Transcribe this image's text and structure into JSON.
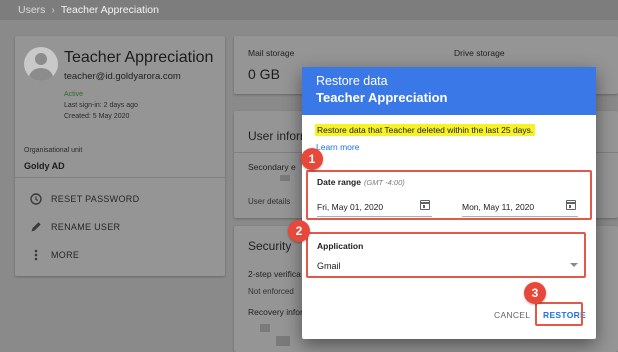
{
  "breadcrumb": {
    "parent": "Users",
    "current": "Teacher Appreciation"
  },
  "user": {
    "name": "Teacher Appreciation",
    "email": "teacher@id.goldyarora.com",
    "status": "Active",
    "last_signin": "Last sign-in: 2 days ago",
    "created": "Created: 5 May 2020"
  },
  "org": {
    "label": "Organisational unit",
    "value": "Goldy AD"
  },
  "actions": [
    {
      "label": "RESET PASSWORD",
      "icon": "key-icon"
    },
    {
      "label": "RENAME USER",
      "icon": "pencil-icon"
    },
    {
      "label": "MORE",
      "icon": "more-vert-icon"
    }
  ],
  "storage": {
    "mail_label": "Mail storage",
    "mail_value": "0 GB",
    "drive_label": "Drive storage"
  },
  "user_info": {
    "title": "User inform",
    "secondary": "Secondary e",
    "details": "User details"
  },
  "security": {
    "title": "Security",
    "two_step": "2-step verifica",
    "not_enforced": "Not enforced",
    "recovery": "Recovery infor"
  },
  "dialog": {
    "title": "Restore data",
    "subtitle": "Teacher Appreciation",
    "notice": "Restore data that Teacher deleted within the last 25 days.",
    "learn_more": "Learn more",
    "date_range_label": "Date range",
    "timezone": "(GMT -4:00)",
    "start_date": "Fri, May 01, 2020",
    "end_date": "Mon, May 11, 2020",
    "application_label": "Application",
    "application_value": "Gmail",
    "cancel_label": "CANCEL",
    "restore_label": "RESTORE"
  },
  "callouts": [
    "1",
    "2",
    "3"
  ],
  "colors": {
    "dialog_header": "#3b78e7",
    "highlight": "#f7f226",
    "callout": "#e8483a",
    "link": "#1a73e8",
    "status_active": "#2f6b2f"
  }
}
